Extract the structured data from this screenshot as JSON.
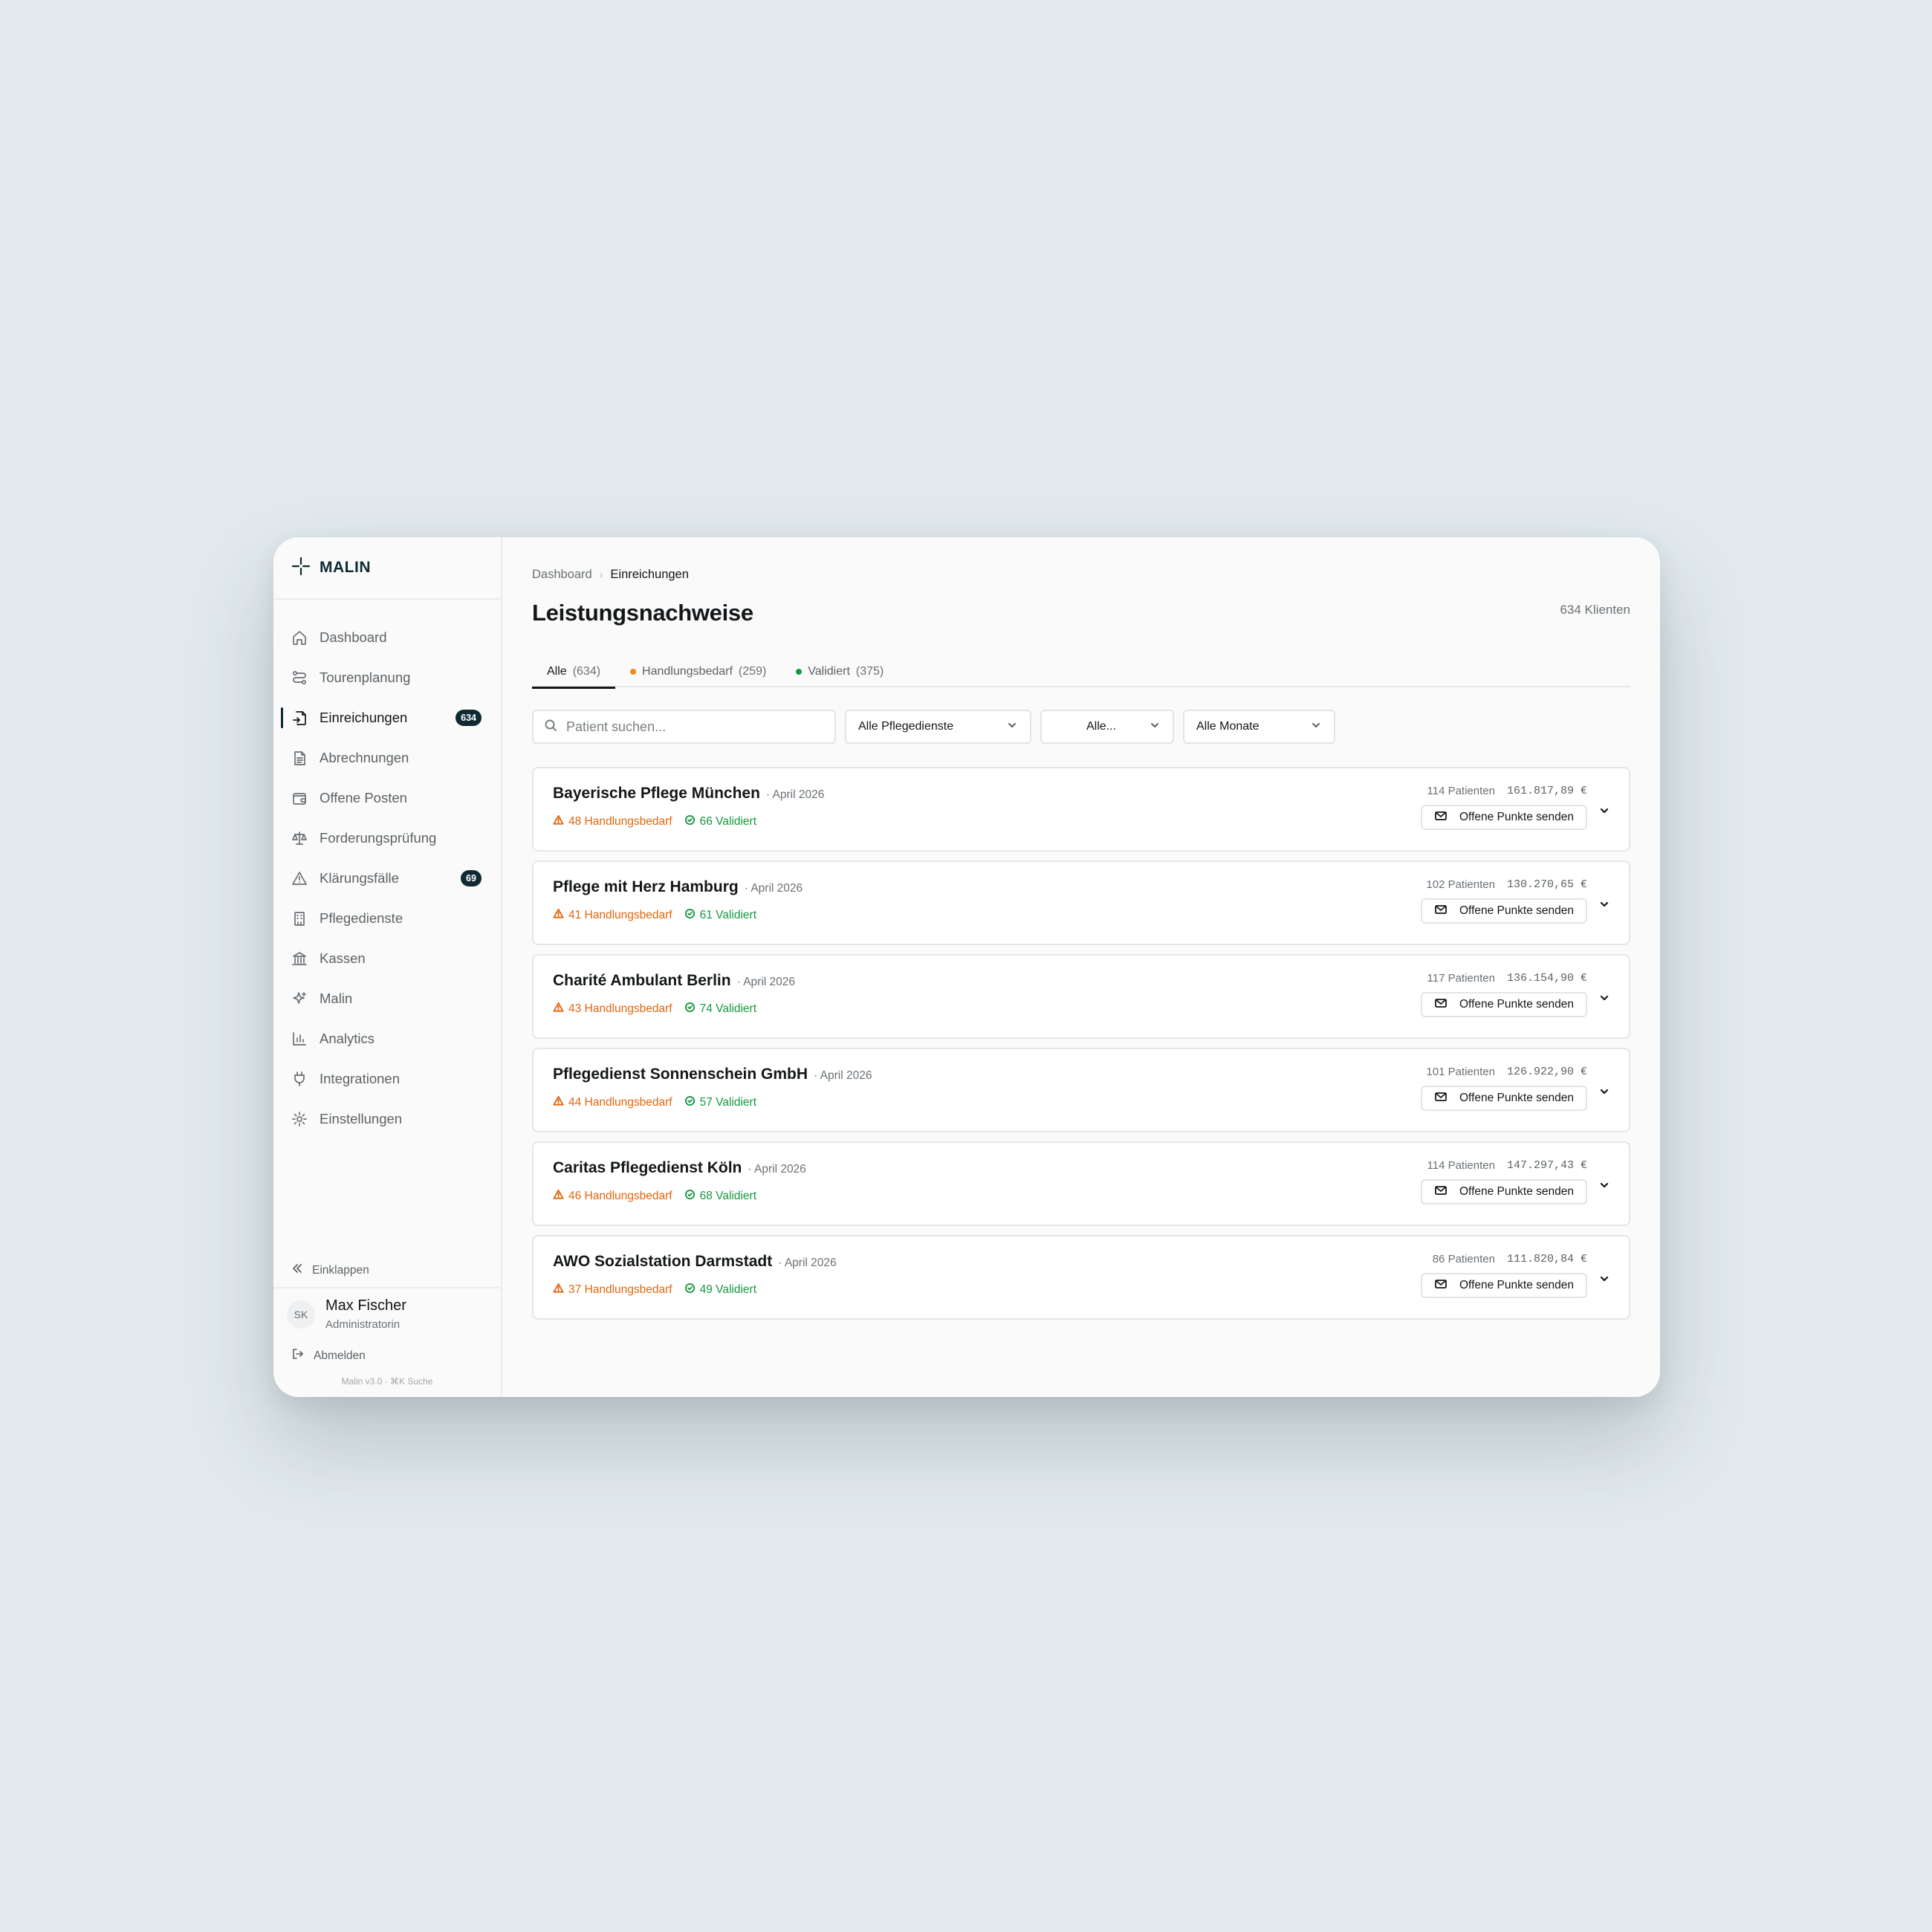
{
  "brand": {
    "name": "MALIN"
  },
  "sidebar": {
    "items": [
      {
        "label": "Dashboard",
        "icon": "home-icon",
        "active": false,
        "badge": null
      },
      {
        "label": "Tourenplanung",
        "icon": "route-icon",
        "active": false,
        "badge": null
      },
      {
        "label": "Einreichungen",
        "icon": "file-import-icon",
        "active": true,
        "badge": "634"
      },
      {
        "label": "Abrechnungen",
        "icon": "document-icon",
        "active": false,
        "badge": null
      },
      {
        "label": "Offene Posten",
        "icon": "wallet-icon",
        "active": false,
        "badge": null
      },
      {
        "label": "Forderungsprüfung",
        "icon": "scale-icon",
        "active": false,
        "badge": null
      },
      {
        "label": "Klärungsfälle",
        "icon": "warning-icon",
        "active": false,
        "badge": "69"
      },
      {
        "label": "Pflegedienste",
        "icon": "building-icon",
        "active": false,
        "badge": null
      },
      {
        "label": "Kassen",
        "icon": "bank-icon",
        "active": false,
        "badge": null
      },
      {
        "label": "Malin",
        "icon": "sparkle-icon",
        "active": false,
        "badge": null
      },
      {
        "label": "Analytics",
        "icon": "bar-chart-icon",
        "active": false,
        "badge": null
      },
      {
        "label": "Integrationen",
        "icon": "plug-icon",
        "active": false,
        "badge": null
      },
      {
        "label": "Einstellungen",
        "icon": "gear-icon",
        "active": false,
        "badge": null
      }
    ],
    "collapse_label": "Einklappen",
    "user": {
      "initials": "SK",
      "name": "Max Fischer",
      "role": "Administratorin"
    },
    "logout_label": "Abmelden",
    "version": "Malin v3.0 · ⌘K Suche"
  },
  "breadcrumb": {
    "root": "Dashboard",
    "current": "Einreichungen"
  },
  "page": {
    "title": "Leistungsnachweise",
    "client_count": "634 Klienten"
  },
  "tabs": [
    {
      "label": "Alle",
      "count": "(634)",
      "active": true,
      "dot": null
    },
    {
      "label": "Handlungsbedarf",
      "count": "(259)",
      "active": false,
      "dot": "#f08a1c"
    },
    {
      "label": "Validiert",
      "count": "(375)",
      "active": false,
      "dot": "#17993f"
    }
  ],
  "filters": {
    "search_placeholder": "Patient suchen...",
    "pflegedienste": "Alle Pflegedienste",
    "status": "Alle...",
    "monate": "Alle Monate"
  },
  "cards": [
    {
      "name": "Bayerische Pflege München",
      "month": "· April 2026",
      "warn": "48 Handlungsbedarf",
      "ok": "66 Validiert",
      "patients": "114 Patienten",
      "amount": "161.817,89 €",
      "action": "Offene Punkte senden"
    },
    {
      "name": "Pflege mit Herz Hamburg",
      "month": "· April 2026",
      "warn": "41 Handlungsbedarf",
      "ok": "61 Validiert",
      "patients": "102 Patienten",
      "amount": "130.270,65 €",
      "action": "Offene Punkte senden"
    },
    {
      "name": "Charité Ambulant Berlin",
      "month": "· April 2026",
      "warn": "43 Handlungsbedarf",
      "ok": "74 Validiert",
      "patients": "117 Patienten",
      "amount": "136.154,90 €",
      "action": "Offene Punkte senden"
    },
    {
      "name": "Pflegedienst Sonnenschein GmbH",
      "month": "· April 2026",
      "warn": "44 Handlungsbedarf",
      "ok": "57 Validiert",
      "patients": "101 Patienten",
      "amount": "126.922,90 €",
      "action": "Offene Punkte senden"
    },
    {
      "name": "Caritas Pflegedienst Köln",
      "month": "· April 2026",
      "warn": "46 Handlungsbedarf",
      "ok": "68 Validiert",
      "patients": "114 Patienten",
      "amount": "147.297,43 €",
      "action": "Offene Punkte senden"
    },
    {
      "name": "AWO Sozialstation Darmstadt",
      "month": "· April 2026",
      "warn": "37 Handlungsbedarf",
      "ok": "49 Validiert",
      "patients": "86 Patienten",
      "amount": "111.820,84 €",
      "action": "Offene Punkte senden"
    }
  ]
}
